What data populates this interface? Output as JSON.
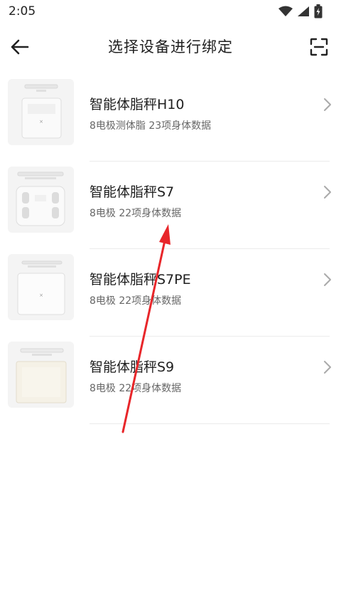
{
  "status_bar": {
    "time": "2:05"
  },
  "header": {
    "title": "选择设备进行绑定"
  },
  "devices": [
    {
      "name": "智能体脂秤H10",
      "desc": "8电极测体脂 23项身体数据"
    },
    {
      "name": "智能体脂秤S7",
      "desc": "8电极 22项身体数据"
    },
    {
      "name": "智能体脂秤S7PE",
      "desc": "8电极 22项身体数据"
    },
    {
      "name": "智能体脂秤S9",
      "desc": "8电极 22项身体数据"
    }
  ],
  "colors": {
    "accent_annotation": "#e8262a",
    "divider": "#ebebeb"
  }
}
